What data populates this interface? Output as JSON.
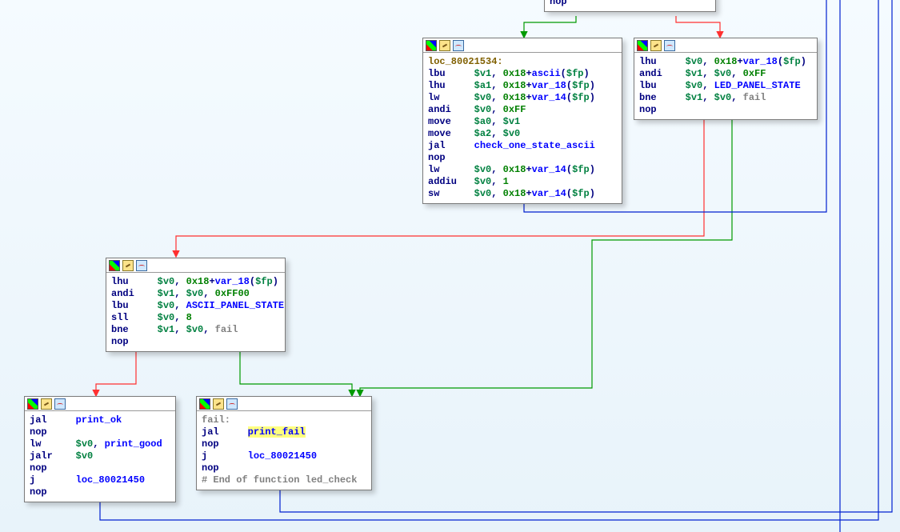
{
  "nodes": {
    "n0": {
      "lines": [
        [
          {
            "cls": "mn",
            "t": "nop"
          }
        ]
      ]
    },
    "n1_left": {
      "lines": [
        [
          {
            "cls": "lbl",
            "t": "loc_80021534"
          },
          {
            "cls": "lbl",
            "t": ":"
          }
        ],
        [
          {
            "cls": "mn",
            "t": "lbu"
          },
          {
            "cls": "sp",
            "t": "     "
          },
          {
            "cls": "reg",
            "t": "$v1"
          },
          {
            "cls": "punct",
            "t": ", "
          },
          {
            "cls": "imm",
            "t": "0x18"
          },
          {
            "cls": "punct",
            "t": "+"
          },
          {
            "cls": "sym",
            "t": "ascii"
          },
          {
            "cls": "punct",
            "t": "("
          },
          {
            "cls": "reg",
            "t": "$fp"
          },
          {
            "cls": "punct",
            "t": ")"
          }
        ],
        [
          {
            "cls": "mn",
            "t": "lhu"
          },
          {
            "cls": "sp",
            "t": "     "
          },
          {
            "cls": "reg",
            "t": "$a1"
          },
          {
            "cls": "punct",
            "t": ", "
          },
          {
            "cls": "imm",
            "t": "0x18"
          },
          {
            "cls": "punct",
            "t": "+"
          },
          {
            "cls": "sym",
            "t": "var_18"
          },
          {
            "cls": "punct",
            "t": "("
          },
          {
            "cls": "reg",
            "t": "$fp"
          },
          {
            "cls": "punct",
            "t": ")"
          }
        ],
        [
          {
            "cls": "mn",
            "t": "lw"
          },
          {
            "cls": "sp",
            "t": "      "
          },
          {
            "cls": "reg",
            "t": "$v0"
          },
          {
            "cls": "punct",
            "t": ", "
          },
          {
            "cls": "imm",
            "t": "0x18"
          },
          {
            "cls": "punct",
            "t": "+"
          },
          {
            "cls": "sym",
            "t": "var_14"
          },
          {
            "cls": "punct",
            "t": "("
          },
          {
            "cls": "reg",
            "t": "$fp"
          },
          {
            "cls": "punct",
            "t": ")"
          }
        ],
        [
          {
            "cls": "mn",
            "t": "andi"
          },
          {
            "cls": "sp",
            "t": "    "
          },
          {
            "cls": "reg",
            "t": "$v0"
          },
          {
            "cls": "punct",
            "t": ", "
          },
          {
            "cls": "imm",
            "t": "0xFF"
          }
        ],
        [
          {
            "cls": "mn",
            "t": "move"
          },
          {
            "cls": "sp",
            "t": "    "
          },
          {
            "cls": "reg",
            "t": "$a0"
          },
          {
            "cls": "punct",
            "t": ", "
          },
          {
            "cls": "reg",
            "t": "$v1"
          }
        ],
        [
          {
            "cls": "mn",
            "t": "move"
          },
          {
            "cls": "sp",
            "t": "    "
          },
          {
            "cls": "reg",
            "t": "$a2"
          },
          {
            "cls": "punct",
            "t": ", "
          },
          {
            "cls": "reg",
            "t": "$v0"
          }
        ],
        [
          {
            "cls": "mn",
            "t": "jal"
          },
          {
            "cls": "sp",
            "t": "     "
          },
          {
            "cls": "sym",
            "t": "check_one_state_ascii"
          }
        ],
        [
          {
            "cls": "mn",
            "t": "nop"
          }
        ],
        [
          {
            "cls": "mn",
            "t": "lw"
          },
          {
            "cls": "sp",
            "t": "      "
          },
          {
            "cls": "reg",
            "t": "$v0"
          },
          {
            "cls": "punct",
            "t": ", "
          },
          {
            "cls": "imm",
            "t": "0x18"
          },
          {
            "cls": "punct",
            "t": "+"
          },
          {
            "cls": "sym",
            "t": "var_14"
          },
          {
            "cls": "punct",
            "t": "("
          },
          {
            "cls": "reg",
            "t": "$fp"
          },
          {
            "cls": "punct",
            "t": ")"
          }
        ],
        [
          {
            "cls": "mn",
            "t": "addiu"
          },
          {
            "cls": "sp",
            "t": "   "
          },
          {
            "cls": "reg",
            "t": "$v0"
          },
          {
            "cls": "punct",
            "t": ", "
          },
          {
            "cls": "imm",
            "t": "1"
          }
        ],
        [
          {
            "cls": "mn",
            "t": "sw"
          },
          {
            "cls": "sp",
            "t": "      "
          },
          {
            "cls": "reg",
            "t": "$v0"
          },
          {
            "cls": "punct",
            "t": ", "
          },
          {
            "cls": "imm",
            "t": "0x18"
          },
          {
            "cls": "punct",
            "t": "+"
          },
          {
            "cls": "sym",
            "t": "var_14"
          },
          {
            "cls": "punct",
            "t": "("
          },
          {
            "cls": "reg",
            "t": "$fp"
          },
          {
            "cls": "punct",
            "t": ")"
          }
        ]
      ]
    },
    "n1_right": {
      "lines": [
        [
          {
            "cls": "mn",
            "t": "lhu"
          },
          {
            "cls": "sp",
            "t": "     "
          },
          {
            "cls": "reg",
            "t": "$v0"
          },
          {
            "cls": "punct",
            "t": ", "
          },
          {
            "cls": "imm",
            "t": "0x18"
          },
          {
            "cls": "punct",
            "t": "+"
          },
          {
            "cls": "sym",
            "t": "var_18"
          },
          {
            "cls": "punct",
            "t": "("
          },
          {
            "cls": "reg",
            "t": "$fp"
          },
          {
            "cls": "punct",
            "t": ")"
          }
        ],
        [
          {
            "cls": "mn",
            "t": "andi"
          },
          {
            "cls": "sp",
            "t": "    "
          },
          {
            "cls": "reg",
            "t": "$v1"
          },
          {
            "cls": "punct",
            "t": ", "
          },
          {
            "cls": "reg",
            "t": "$v0"
          },
          {
            "cls": "punct",
            "t": ", "
          },
          {
            "cls": "imm",
            "t": "0xFF"
          }
        ],
        [
          {
            "cls": "mn",
            "t": "lbu"
          },
          {
            "cls": "sp",
            "t": "     "
          },
          {
            "cls": "reg",
            "t": "$v0"
          },
          {
            "cls": "punct",
            "t": ", "
          },
          {
            "cls": "sym",
            "t": "LED_PANEL_STATE"
          }
        ],
        [
          {
            "cls": "mn",
            "t": "bne"
          },
          {
            "cls": "sp",
            "t": "     "
          },
          {
            "cls": "reg",
            "t": "$v1"
          },
          {
            "cls": "punct",
            "t": ", "
          },
          {
            "cls": "reg",
            "t": "$v0"
          },
          {
            "cls": "punct",
            "t": ", "
          },
          {
            "cls": "cmt",
            "t": "fail"
          }
        ],
        [
          {
            "cls": "mn",
            "t": "nop"
          }
        ]
      ]
    },
    "n2": {
      "lines": [
        [
          {
            "cls": "mn",
            "t": "lhu"
          },
          {
            "cls": "sp",
            "t": "     "
          },
          {
            "cls": "reg",
            "t": "$v0"
          },
          {
            "cls": "punct",
            "t": ", "
          },
          {
            "cls": "imm",
            "t": "0x18"
          },
          {
            "cls": "punct",
            "t": "+"
          },
          {
            "cls": "sym",
            "t": "var_18"
          },
          {
            "cls": "punct",
            "t": "("
          },
          {
            "cls": "reg",
            "t": "$fp"
          },
          {
            "cls": "punct",
            "t": ")"
          }
        ],
        [
          {
            "cls": "mn",
            "t": "andi"
          },
          {
            "cls": "sp",
            "t": "    "
          },
          {
            "cls": "reg",
            "t": "$v1"
          },
          {
            "cls": "punct",
            "t": ", "
          },
          {
            "cls": "reg",
            "t": "$v0"
          },
          {
            "cls": "punct",
            "t": ", "
          },
          {
            "cls": "imm",
            "t": "0xFF00"
          }
        ],
        [
          {
            "cls": "mn",
            "t": "lbu"
          },
          {
            "cls": "sp",
            "t": "     "
          },
          {
            "cls": "reg",
            "t": "$v0"
          },
          {
            "cls": "punct",
            "t": ", "
          },
          {
            "cls": "sym",
            "t": "ASCII_PANEL_STATE"
          }
        ],
        [
          {
            "cls": "mn",
            "t": "sll"
          },
          {
            "cls": "sp",
            "t": "     "
          },
          {
            "cls": "reg",
            "t": "$v0"
          },
          {
            "cls": "punct",
            "t": ", "
          },
          {
            "cls": "imm",
            "t": "8"
          }
        ],
        [
          {
            "cls": "mn",
            "t": "bne"
          },
          {
            "cls": "sp",
            "t": "     "
          },
          {
            "cls": "reg",
            "t": "$v1"
          },
          {
            "cls": "punct",
            "t": ", "
          },
          {
            "cls": "reg",
            "t": "$v0"
          },
          {
            "cls": "punct",
            "t": ", "
          },
          {
            "cls": "cmt",
            "t": "fail"
          }
        ],
        [
          {
            "cls": "mn",
            "t": "nop"
          }
        ]
      ]
    },
    "n3_left": {
      "lines": [
        [
          {
            "cls": "mn",
            "t": "jal"
          },
          {
            "cls": "sp",
            "t": "     "
          },
          {
            "cls": "sym",
            "t": "print_ok"
          }
        ],
        [
          {
            "cls": "mn",
            "t": "nop"
          }
        ],
        [
          {
            "cls": "mn",
            "t": "lw"
          },
          {
            "cls": "sp",
            "t": "      "
          },
          {
            "cls": "reg",
            "t": "$v0"
          },
          {
            "cls": "punct",
            "t": ", "
          },
          {
            "cls": "sym",
            "t": "print_good"
          }
        ],
        [
          {
            "cls": "mn",
            "t": "jalr"
          },
          {
            "cls": "sp",
            "t": "    "
          },
          {
            "cls": "reg",
            "t": "$v0"
          }
        ],
        [
          {
            "cls": "mn",
            "t": "nop"
          }
        ],
        [
          {
            "cls": "mn",
            "t": "j"
          },
          {
            "cls": "sp",
            "t": "       "
          },
          {
            "cls": "sym",
            "t": "loc_80021450"
          }
        ],
        [
          {
            "cls": "mn",
            "t": "nop"
          }
        ]
      ]
    },
    "n3_right": {
      "lines": [
        [
          {
            "cls": "cmt",
            "t": "fail:"
          }
        ],
        [
          {
            "cls": "mn",
            "t": "jal"
          },
          {
            "cls": "sp",
            "t": "     "
          },
          {
            "cls": "sym hl",
            "t": "print_fail"
          }
        ],
        [
          {
            "cls": "mn",
            "t": "nop"
          }
        ],
        [
          {
            "cls": "mn",
            "t": "j"
          },
          {
            "cls": "sp",
            "t": "       "
          },
          {
            "cls": "sym",
            "t": "loc_80021450"
          }
        ],
        [
          {
            "cls": "mn",
            "t": "nop"
          }
        ],
        [
          {
            "cls": "cmt",
            "t": "# End of function led_check"
          }
        ]
      ]
    }
  }
}
